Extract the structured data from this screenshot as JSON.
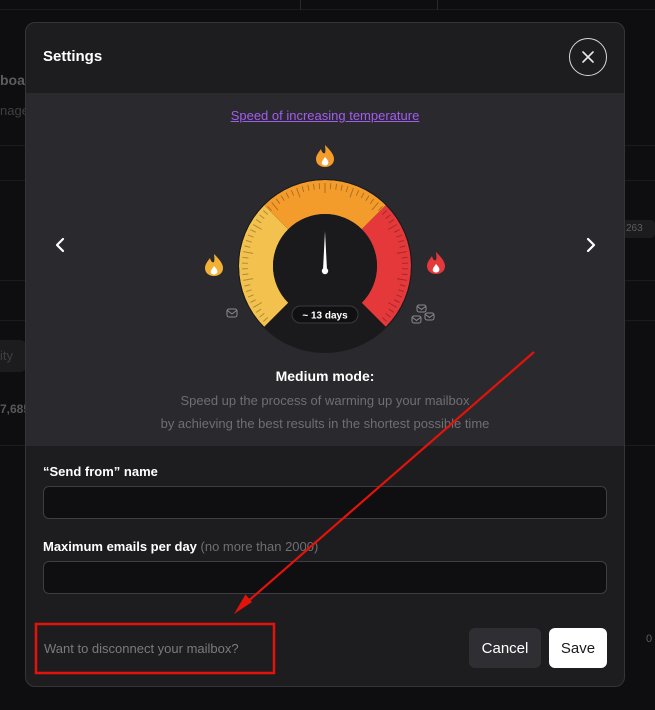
{
  "background": {
    "title_fragment": "boa",
    "subtitle_fragment": "nage",
    "pill_fragment": "ity",
    "number_fragment": "7,685",
    "badge_fragment": "263",
    "right_fragment": "0"
  },
  "modal": {
    "title": "Settings",
    "close_icon": "close-icon"
  },
  "speed": {
    "link_label": "Speed of increasing temperature",
    "days_label": "~ 13 days",
    "mode_title": "Medium mode:",
    "mode_desc_line1": "Speed up the process of warming up your mailbox",
    "mode_desc_line2": "by achieving the best results in the shortest possible time",
    "gauge_level": 0.5,
    "colors": {
      "low": "#f2c14e",
      "medium": "#f39c2b",
      "high": "#e5383b",
      "link": "#a35cf0"
    },
    "icons": [
      "chevron-left-icon",
      "chevron-right-icon",
      "flame-icon",
      "envelope-icon"
    ]
  },
  "form": {
    "send_from_label": "“Send from” name",
    "send_from_value": "",
    "max_label": "Maximum emails per day",
    "max_note": "(no more than 2000)",
    "max_value": ""
  },
  "footer": {
    "disconnect_label": "Want to disconnect your mailbox?",
    "cancel_label": "Cancel",
    "save_label": "Save"
  },
  "annotation": {
    "color": "#e3120b"
  }
}
